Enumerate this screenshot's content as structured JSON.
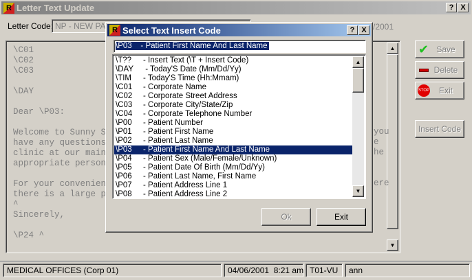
{
  "window": {
    "title": "Letter Text Update",
    "help": "?",
    "close": "X"
  },
  "letter_code": {
    "label": "Letter Code:",
    "value": "NP - NEW PAT",
    "date_fragment": "/2001"
  },
  "editor": {
    "lines": [
      "\\C01",
      "\\C02",
      "\\C03",
      "",
      "\\DAY",
      "",
      "Dear \\P03:",
      "",
      "Welcome to Sunny St",
      "have any questions",
      "clinic at our main",
      "appropriate person",
      "",
      "For your convenienc",
      "there is a large pa",
      "^",
      "Sincerely,",
      "",
      "\\P24 ^"
    ],
    "right_fragments": [
      {
        "row": 8,
        "text": "you"
      },
      {
        "row": 9,
        "text": "e"
      },
      {
        "row": 10,
        "text": "he"
      },
      {
        "row": 13,
        "text": "ere"
      }
    ]
  },
  "buttons": {
    "save": "Save",
    "delete": "Delete",
    "exit": "Exit",
    "insert_code": "Insert Code"
  },
  "dialog": {
    "title": "Select Text Insert Code",
    "help": "?",
    "close": "X",
    "input_value": "\\P03    - Patient First Name And Last Name",
    "items": [
      {
        "code": "\\T??",
        "desc": "- Insert Text (\\T + Insert Code)"
      },
      {
        "code": "\\DAY",
        "desc": " - Today'S Date (Mm/Dd/Yy)"
      },
      {
        "code": "\\TIM",
        "desc": "- Today'S Time (Hh:Mmam)"
      },
      {
        "code": "\\C01",
        "desc": "- Corporate Name"
      },
      {
        "code": "\\C02",
        "desc": "- Corporate Street Address"
      },
      {
        "code": "\\C03",
        "desc": "- Corporate City/State/Zip"
      },
      {
        "code": "\\C04",
        "desc": "- Corporate Telephone Number"
      },
      {
        "code": "\\P00",
        "desc": "- Patient Number"
      },
      {
        "code": "\\P01",
        "desc": "- Patient First Name"
      },
      {
        "code": "\\P02",
        "desc": "- Patient Last Name"
      },
      {
        "code": "\\P03",
        "desc": "- Patient First Name And Last Name"
      },
      {
        "code": "\\P04",
        "desc": "- Patient Sex (Male/Female/Unknown)"
      },
      {
        "code": "\\P05",
        "desc": "- Patient Date Of Birth (Mm/Dd/Yy)"
      },
      {
        "code": "\\P06",
        "desc": "- Patient Last Name, First Name"
      },
      {
        "code": "\\P07",
        "desc": "- Patient Address Line 1"
      },
      {
        "code": "\\P08",
        "desc": "- Patient Address Line 2"
      }
    ],
    "selected_index": 10,
    "ok": "Ok",
    "exit": "Exit"
  },
  "status": {
    "corp": "MEDICAL OFFICES (Corp 01)",
    "datetime": "04/06/2001  8:21 am",
    "terminal": "T01-VU",
    "user": "ann"
  },
  "colors": {
    "active_title": "#0a246a",
    "inactive_title": "#808080",
    "selection": "#0a246a"
  }
}
